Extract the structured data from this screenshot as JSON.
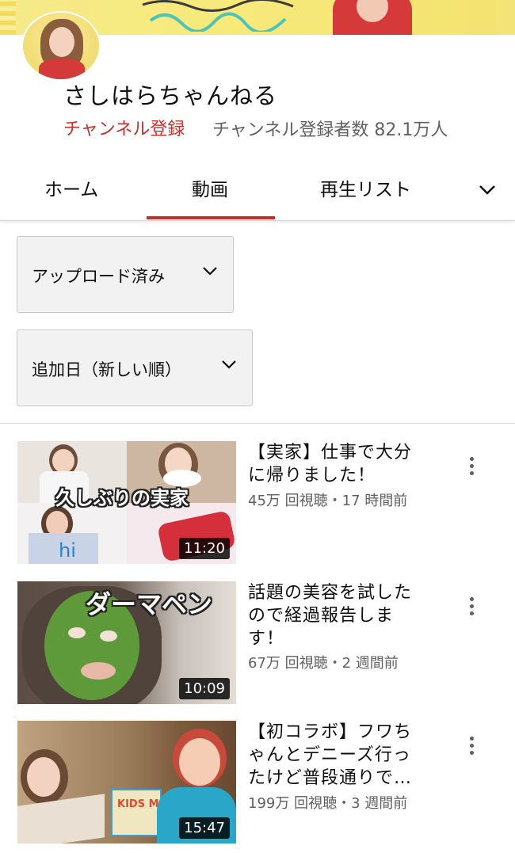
{
  "channel": {
    "name": "さしはらちゃんねる",
    "subscribe_label": "チャンネル登録",
    "subscriber_count": "チャンネル登録者数 82.1万人"
  },
  "tabs": [
    {
      "label": "ホーム",
      "active": false
    },
    {
      "label": "動画",
      "active": true
    },
    {
      "label": "再生リスト",
      "active": false
    }
  ],
  "filters": {
    "upload": "アップロード済み",
    "sort": "追加日（新しい順）"
  },
  "videos": [
    {
      "title": "【実家】仕事で大分に帰りました！",
      "title_lines": [
        "【実家】仕事で大分",
        "に帰りました！"
      ],
      "meta": "45万 回視聴・17 時間前",
      "duration": "11:20",
      "thumb_text": "久しぶりの実家"
    },
    {
      "title": "話題の美容を試したので経過報告します！",
      "title_lines": [
        "話題の美容を試した",
        "ので経過報告しま",
        "す！"
      ],
      "meta": "67万 回視聴・2 週間前",
      "duration": "10:09",
      "thumb_text": "ダーマペン"
    },
    {
      "title": "【初コラボ】フワちゃんとデニーズ行ったけど普段通りで…",
      "title_lines": [
        "【初コラボ】フワち",
        "ゃんとデニーズ行っ",
        "たけど普段通りで…"
      ],
      "meta": "199万 回視聴・3 週間前",
      "duration": "15:47",
      "thumb_text": "KIDS MENU"
    }
  ],
  "colors": {
    "accent": "#c4302b",
    "meta_text": "#606060",
    "banner": "#f5e98a"
  },
  "icons": {
    "tab_more": "chevron-down-icon",
    "filter": "chevron-down-icon",
    "video_menu": "more-vert-icon"
  }
}
